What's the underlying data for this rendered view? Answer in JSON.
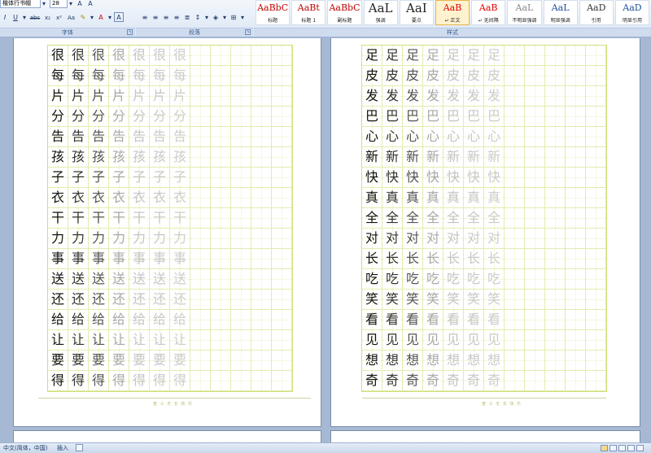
{
  "ribbon": {
    "font_name": "楷体行书帽",
    "font_size": "28",
    "font_group_label": "字体",
    "paragraph_group_label": "段落",
    "styles_group_label": "样式",
    "format_buttons": [
      "I",
      "U",
      "abc",
      "x₂",
      "x²",
      "Aa",
      "A",
      "A"
    ],
    "grow_font": "A",
    "shrink_font": "A",
    "styles": [
      {
        "sample": "AaBbC",
        "name": "标题",
        "color": "#c00000"
      },
      {
        "sample": "AaBt",
        "name": "标题 1",
        "color": "#c00000"
      },
      {
        "sample": "AaBbC",
        "name": "副标题",
        "color": "#c00000"
      },
      {
        "sample": "AaL",
        "name": "强调",
        "color": "#222222"
      },
      {
        "sample": "AaI",
        "name": "要点",
        "color": "#222222"
      },
      {
        "sample": "AaB",
        "name": "↵ 正文",
        "color": "#e60000"
      },
      {
        "sample": "AaB",
        "name": "↵ 无间隔",
        "color": "#e60000"
      },
      {
        "sample": "AaL",
        "name": "不明显强调",
        "color": "#888888"
      },
      {
        "sample": "AaL",
        "name": "明显强调",
        "color": "#1f4e99"
      },
      {
        "sample": "AaD",
        "name": "引用",
        "color": "#333333"
      },
      {
        "sample": "AaD",
        "name": "明显引用",
        "color": "#1f4e99"
      }
    ]
  },
  "pages": [
    {
      "chars": [
        "很",
        "每",
        "片",
        "分",
        "告",
        "孩",
        "子",
        "衣",
        "干",
        "力",
        "事",
        "送",
        "还",
        "给",
        "让",
        "要",
        "得"
      ],
      "footer": "奋 斗 无 长 快 乐"
    },
    {
      "chars": [
        "足",
        "皮",
        "发",
        "巴",
        "心",
        "新",
        "快",
        "真",
        "全",
        "对",
        "长",
        "吃",
        "笑",
        "看",
        "见",
        "想",
        "奇"
      ],
      "footer": "奋 斗 无 长 快 乐"
    }
  ],
  "char_shades": [
    "#111111",
    "#333333",
    "#555555",
    "#a8a8a8",
    "#c4c4c4",
    "#c8c8c8",
    "#cccccc"
  ],
  "status": {
    "language": "中文(简体，中国)",
    "mode": "插入"
  }
}
